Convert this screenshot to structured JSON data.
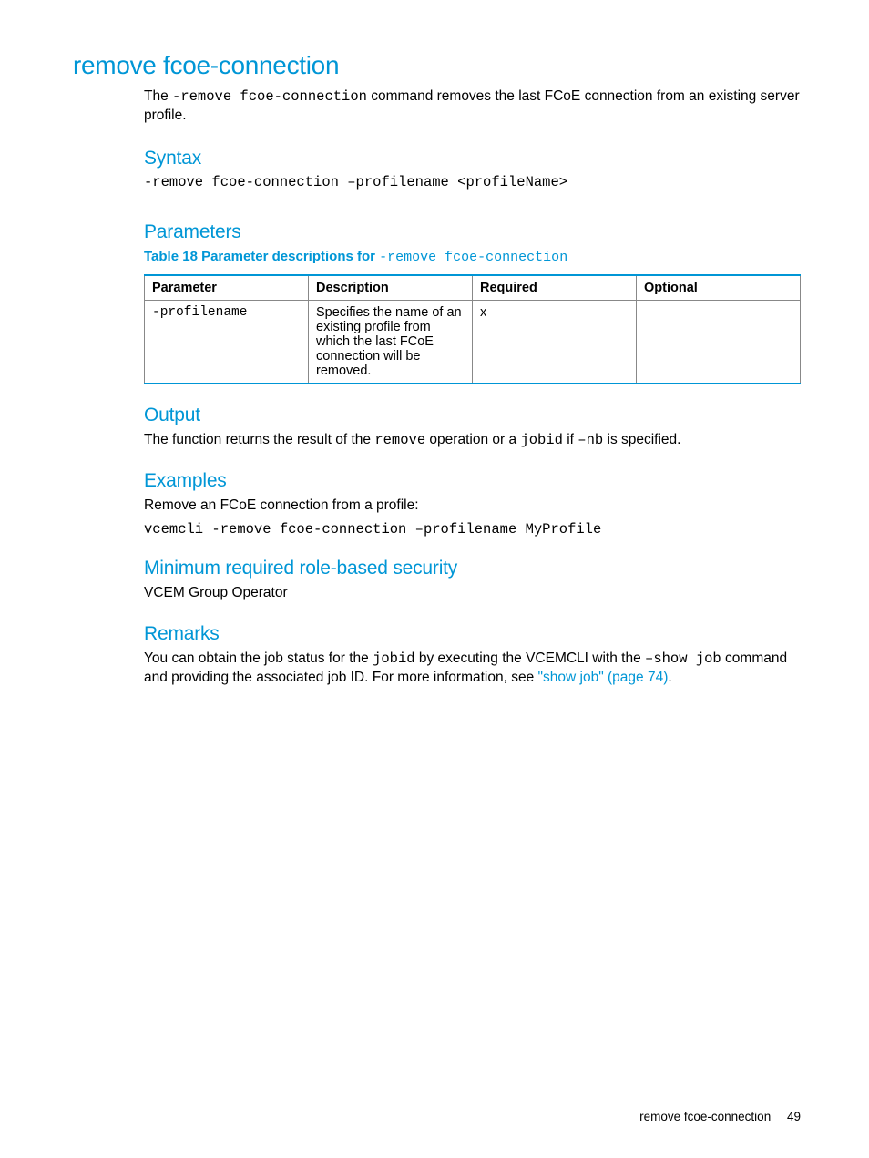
{
  "title": "remove fcoe-connection",
  "intro": {
    "pre_text": "The ",
    "command": "-remove fcoe-connection",
    "post_text": " command removes the last FCoE connection from an existing server profile."
  },
  "syntax": {
    "heading": "Syntax",
    "code": "-remove fcoe-connection –profilename <profileName>"
  },
  "parameters": {
    "heading": "Parameters",
    "table_caption_prefix": "Table 18 Parameter descriptions for ",
    "table_caption_code": "-remove fcoe-connection",
    "headers": {
      "parameter": "Parameter",
      "description": "Description",
      "required": "Required",
      "optional": "Optional"
    },
    "rows": [
      {
        "parameter": "-profilename",
        "description": "Specifies the name of an existing profile from which the last FCoE connection will be removed.",
        "required": "x",
        "optional": ""
      }
    ]
  },
  "output": {
    "heading": "Output",
    "text_1": "The function returns the result of the ",
    "code_1": "remove",
    "text_2": " operation or a ",
    "code_2": "jobid",
    "text_3": " if ",
    "code_3": "–nb",
    "text_4": " is specified."
  },
  "examples": {
    "heading": "Examples",
    "intro": "Remove an FCoE connection from a profile:",
    "code": "vcemcli -remove fcoe-connection –profilename MyProfile"
  },
  "security": {
    "heading": "Minimum required role-based security",
    "text": "VCEM Group Operator"
  },
  "remarks": {
    "heading": "Remarks",
    "text_1": "You can obtain the job status for the ",
    "code_1": "jobid",
    "text_2": " by executing the VCEMCLI with the ",
    "code_2": "–show job",
    "text_3": " command and providing the associated job ID. For more information, see ",
    "link": "\"show job\" (page 74)",
    "text_4": "."
  },
  "footer": {
    "label": "remove fcoe-connection",
    "page_num": "49"
  }
}
